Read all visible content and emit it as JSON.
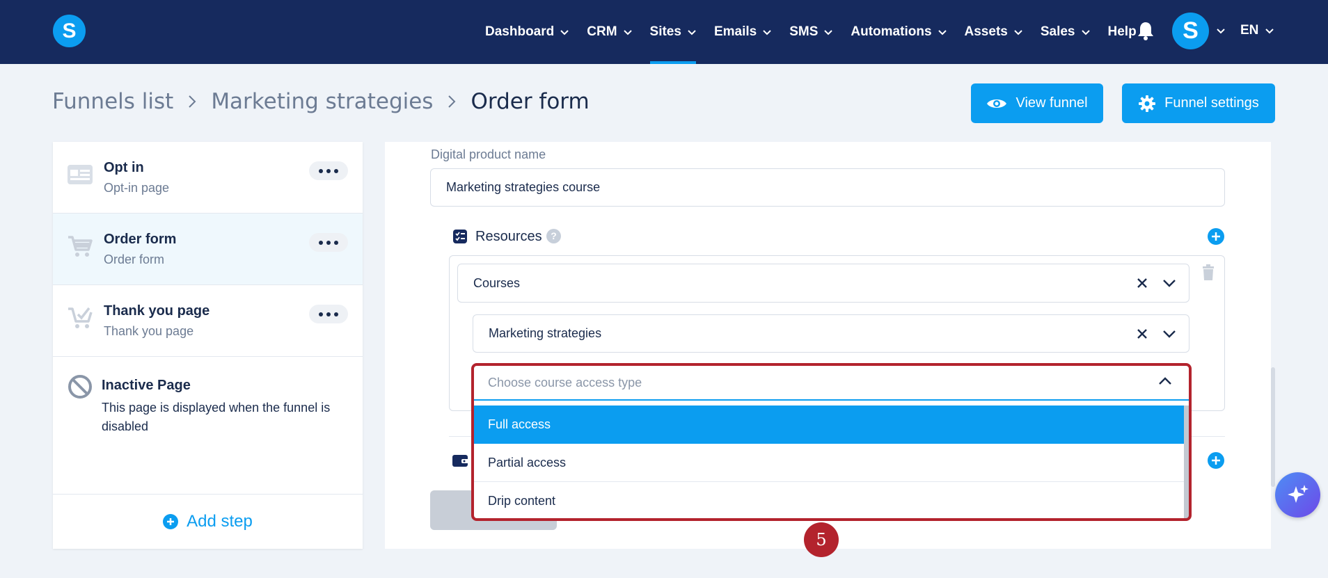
{
  "brand": {
    "logo_letter": "S"
  },
  "nav": {
    "items": [
      {
        "label": "Dashboard",
        "has_menu": true
      },
      {
        "label": "CRM",
        "has_menu": true
      },
      {
        "label": "Sites",
        "has_menu": true,
        "active": true
      },
      {
        "label": "Emails",
        "has_menu": true
      },
      {
        "label": "SMS",
        "has_menu": true
      },
      {
        "label": "Automations",
        "has_menu": true
      },
      {
        "label": "Assets",
        "has_menu": true
      },
      {
        "label": "Sales",
        "has_menu": true
      },
      {
        "label": "Help",
        "has_menu": false
      }
    ],
    "avatar_letter": "S",
    "language": "EN"
  },
  "breadcrumb": {
    "items": [
      "Funnels list",
      "Marketing strategies"
    ],
    "current": "Order form"
  },
  "actions": {
    "view_funnel": "View funnel",
    "funnel_settings": "Funnel settings"
  },
  "steps": [
    {
      "title": "Opt in",
      "subtitle": "Opt-in page"
    },
    {
      "title": "Order form",
      "subtitle": "Order form",
      "selected": true
    },
    {
      "title": "Thank you page",
      "subtitle": "Thank you page"
    }
  ],
  "inactive": {
    "title": "Inactive Page",
    "description": "This page is displayed when the funnel is disabled"
  },
  "add_step": "Add step",
  "form": {
    "digital_product_label": "Digital product name",
    "digital_product_value": "Marketing strategies course",
    "resources_label": "Resources",
    "resources_help": "?",
    "resource_type": "Courses",
    "course": "Marketing strategies",
    "access_placeholder": "Choose course access type",
    "access_options": [
      "Full access",
      "Partial access",
      "Drip content"
    ],
    "highlighted_option": "Full access"
  },
  "annotation": {
    "step_number": "5"
  },
  "colors": {
    "nav_bg": "#162a5e",
    "accent": "#0b9df0",
    "highlight_red": "#b3232d",
    "page_bg": "#eff3f8"
  }
}
